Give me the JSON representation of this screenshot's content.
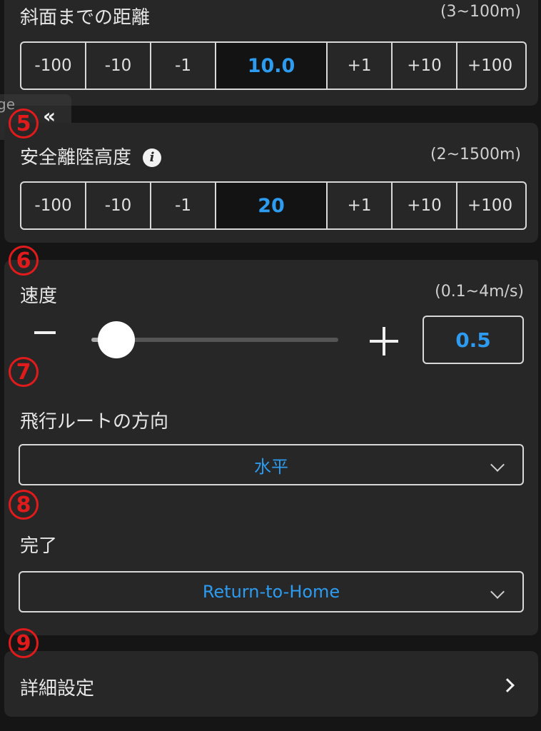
{
  "distance": {
    "label": "斜面までの距離",
    "range": "(3~100m)",
    "steps": [
      "-100",
      "-10",
      "-1",
      "10.0",
      "+1",
      "+10",
      "+100"
    ]
  },
  "safe_altitude": {
    "label": "安全離陸高度",
    "range": "(2~1500m)",
    "info_icon": "i",
    "steps": [
      "-100",
      "-10",
      "-1",
      "20",
      "+1",
      "+10",
      "+100"
    ]
  },
  "speed": {
    "label": "速度",
    "range": "(0.1~4m/s)",
    "value": "0.5",
    "slider_fraction": 0.1
  },
  "route_direction": {
    "label": "飛行ルートの方向",
    "selected": "水平"
  },
  "completion": {
    "label": "完了",
    "selected": "Return-to-Home"
  },
  "advanced": {
    "label": "詳細設定"
  },
  "side_tab": {
    "text": "ge",
    "collapse": "«"
  },
  "badges": [
    "5",
    "6",
    "7",
    "8",
    "9"
  ],
  "colors": {
    "accent": "#2c9bf0",
    "badge": "#e11b1b",
    "card": "#272727",
    "background": "#151515"
  }
}
